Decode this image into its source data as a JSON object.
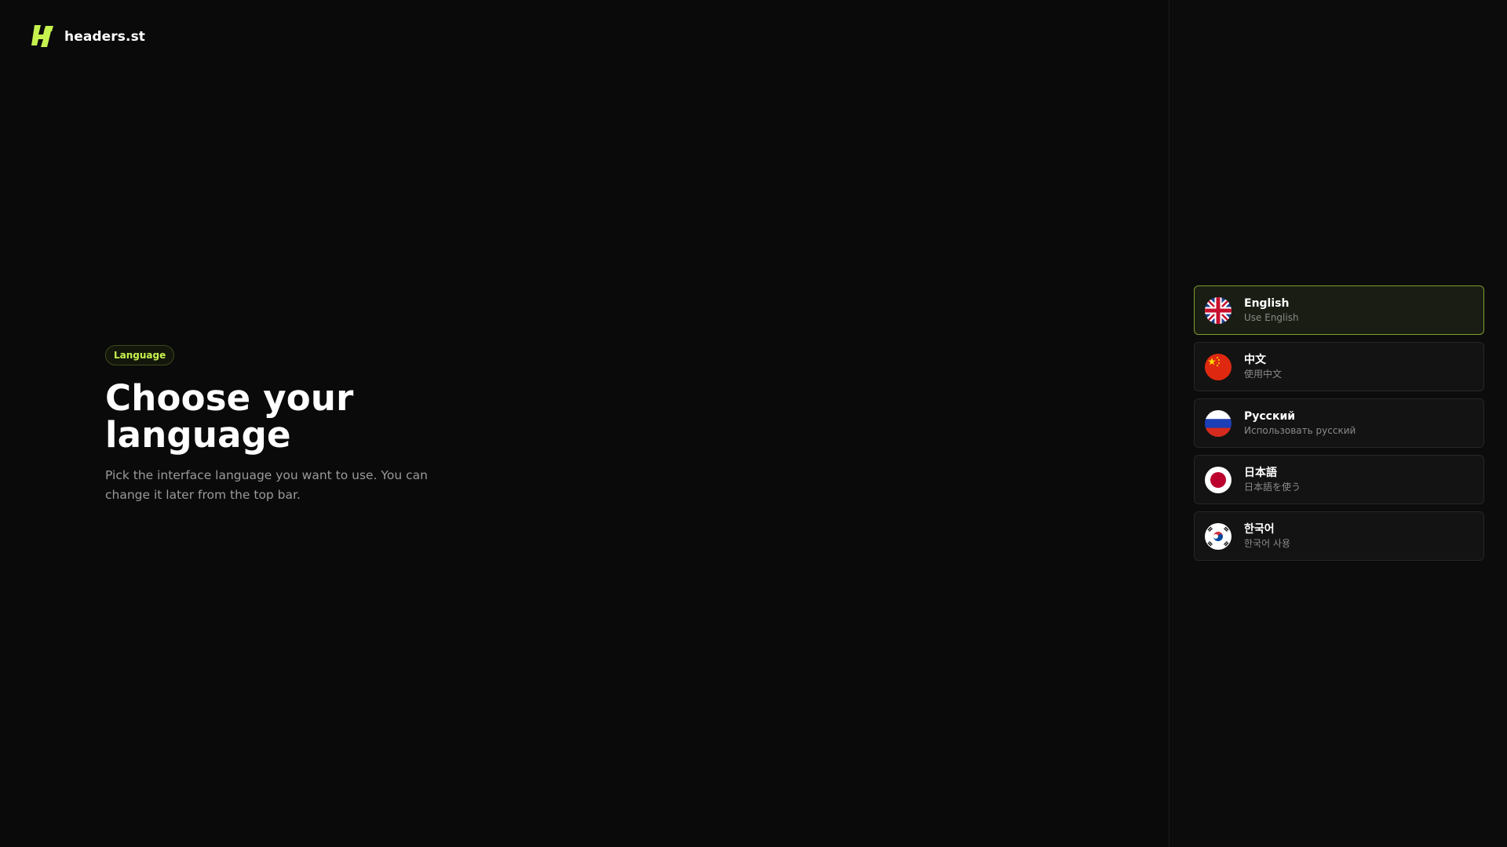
{
  "brand": {
    "name": "headers.st",
    "logo_icon": "lightning-logo-icon",
    "accent_color": "#c6f24e"
  },
  "hero": {
    "badge": "Language",
    "title": "Choose your language",
    "subtitle": "Pick the interface language you want to use. You can change it later from the top bar."
  },
  "languages": [
    {
      "name": "English",
      "description": "Use English",
      "flag_icon": "uk-flag-icon",
      "selected": true
    },
    {
      "name": "中文",
      "description": "使用中文",
      "flag_icon": "china-flag-icon",
      "selected": false
    },
    {
      "name": "Русский",
      "description": "Использовать русский",
      "flag_icon": "russia-flag-icon",
      "selected": false
    },
    {
      "name": "日本語",
      "description": "日本語を使う",
      "flag_icon": "japan-flag-icon",
      "selected": false
    },
    {
      "name": "한국어",
      "description": "한국어 사용",
      "flag_icon": "korea-flag-icon",
      "selected": false
    }
  ]
}
